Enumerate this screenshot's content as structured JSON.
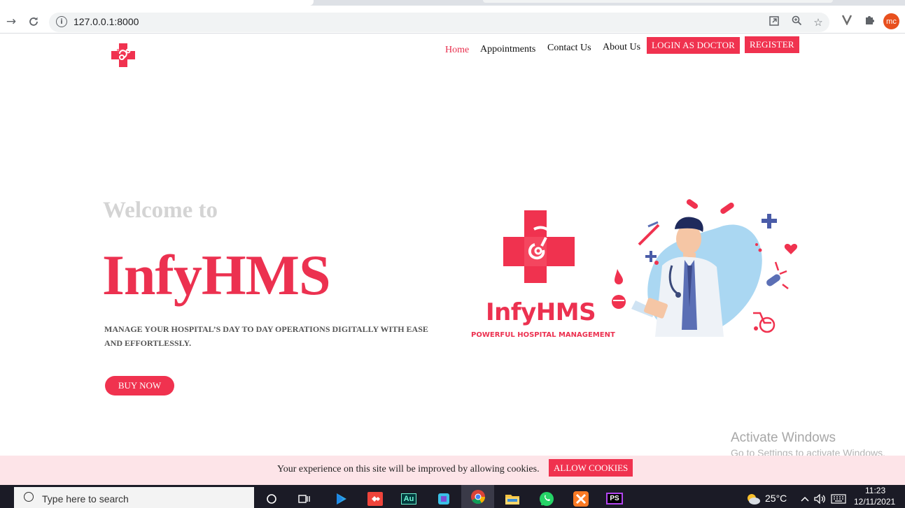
{
  "browser": {
    "url": "127.0.0.1:8000",
    "profile_initials": "mc",
    "icons": [
      "back-icon",
      "forward-icon",
      "reload-icon",
      "site-info-icon",
      "open-in-app-icon",
      "zoom-icon",
      "bookmark-star-icon",
      "extension-vpn-icon",
      "extensions-puzzle-icon"
    ]
  },
  "nav": {
    "home": "Home",
    "appointments": "Appointments",
    "contact": "Contact Us",
    "about": "About Us",
    "login_doctor": "LOGIN AS DOCTOR",
    "register": "REGISTER"
  },
  "hero": {
    "welcome": "Welcome to",
    "title": "InfyHMS",
    "tagline": "MANAGE YOUR HOSPITAL’S DAY TO DAY OPERATIONS DIGITALLY WITH EASE AND EFFORTLESSLY.",
    "cta": "BUY NOW"
  },
  "illustration": {
    "brand": "InfyHMS",
    "brand_subtitle": "POWERFUL HOSPITAL MANAGEMENT"
  },
  "watermark": {
    "title": "Activate Windows",
    "subtitle": "Go to Settings to activate Windows."
  },
  "cookie": {
    "message": "Your experience on this site will be improved by allowing cookies.",
    "button": "ALLOW COOKIES"
  },
  "taskbar": {
    "search_placeholder": "Type here to search",
    "apps": [
      "cortana-icon",
      "task-view-icon",
      "play-store-icon",
      "anydesk-icon",
      "audition-icon",
      "app-icon",
      "chrome-icon",
      "file-explorer-icon",
      "whatsapp-icon",
      "xampp-icon",
      "phpstorm-icon"
    ],
    "app_labels": {
      "audition": "Au",
      "phpstorm": "PS"
    },
    "weather": "25°C",
    "time": "11:23",
    "date": "12/11/2021"
  },
  "colors": {
    "brand_red": "#f0324f",
    "accent_pink": "#ec3150",
    "cookie_bg": "#fde4e8"
  }
}
